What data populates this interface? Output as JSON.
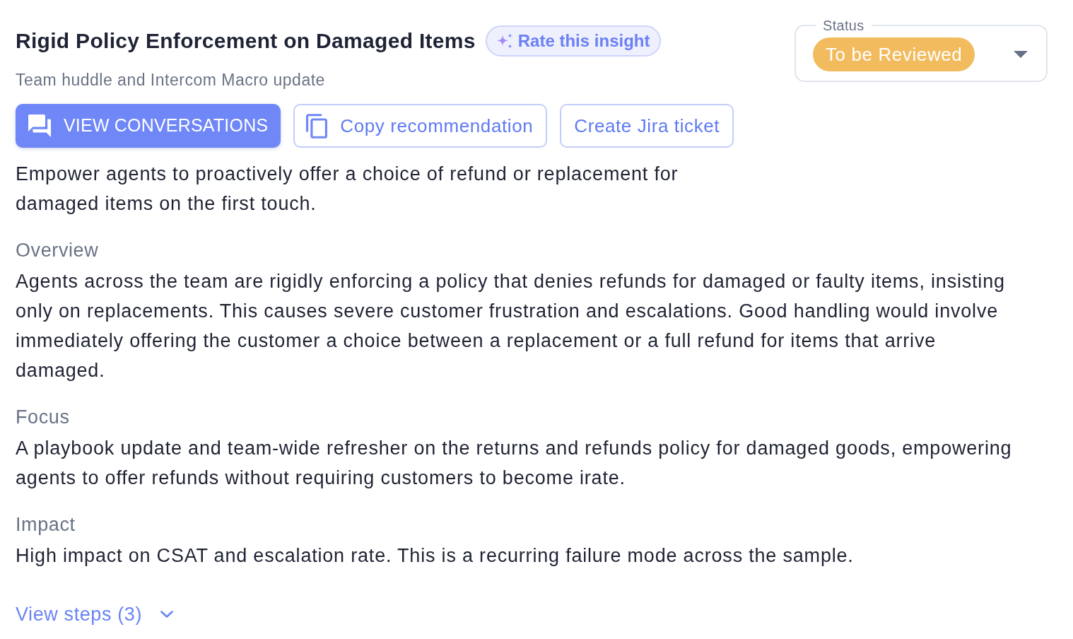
{
  "header": {
    "title": "Rigid Policy Enforcement on Damaged Items",
    "rate_button": "Rate this insight",
    "subtitle": "Team huddle and Intercom Macro update",
    "actions": [
      {
        "kind": "primary",
        "label": "VIEW CONVERSATIONS"
      },
      {
        "kind": "copy",
        "label": "Copy recommendation"
      },
      {
        "kind": "plain",
        "label": "Create Jira ticket"
      }
    ],
    "description": "Empower agents to proactively offer a choice of refund or replacement for damaged items on the first touch."
  },
  "status": {
    "label": "Status",
    "value": "To be Reviewed"
  },
  "sections": [
    {
      "heading": "Overview",
      "body": "Agents across the team are rigidly enforcing a policy that denies refunds for damaged or faulty items, insisting only on replacements. This causes severe customer frustration and escalations. Good handling would involve immediately offering the customer a choice between a replacement or a full refund for items that arrive damaged."
    },
    {
      "heading": "Focus",
      "body": "A playbook update and team-wide refresher on the returns and refunds policy for damaged goods, empowering agents to offer refunds without requiring customers to become irate."
    },
    {
      "heading": "Impact",
      "body": "High impact on CSAT and escalation rate. This is a recurring failure mode across the sample."
    }
  ],
  "steps_toggle": {
    "label": "View steps (3)",
    "expanded": false
  }
}
